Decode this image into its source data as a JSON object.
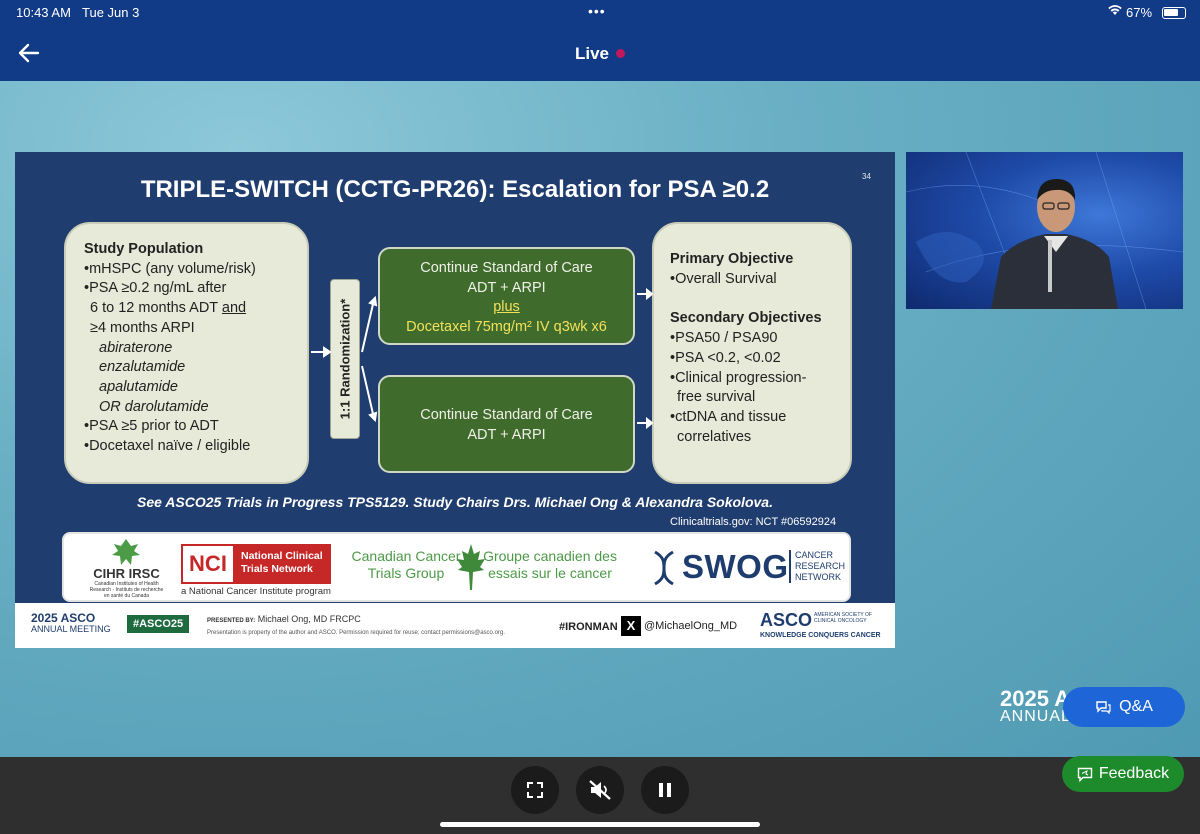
{
  "status_bar": {
    "time": "10:43 AM",
    "date": "Tue Jun 3",
    "dots": "•••",
    "battery": "67%"
  },
  "header": {
    "title": "Live"
  },
  "slide": {
    "number": "34",
    "title": "TRIPLE-SWITCH (CCTG-PR26):  Escalation for PSA ≥0.2",
    "study_population": {
      "heading": "Study Population",
      "b1": "•mHSPC (any volume/risk)",
      "b2": "•PSA ≥0.2 ng/mL after",
      "b2_l2": "6 to 12 months ADT ",
      "b2_and": "and",
      "b2_l3": "≥4 months ARPI",
      "drug1": "abiraterone",
      "drug2": "enzalutamide",
      "drug3": "apalutamide",
      "drug4": "OR darolutamide",
      "b3": "•PSA ≥5 prior to ADT",
      "b4": "•Docetaxel naïve / eligible"
    },
    "randomization": "1:1 Randomization*",
    "arm1": {
      "l1": "Continue Standard of Care",
      "l2": "ADT + ARPI",
      "plus": "plus",
      "l4": "Docetaxel 75mg/m² IV q3wk x6"
    },
    "arm2": {
      "l1": "Continue Standard of Care",
      "l2": "ADT + ARPI"
    },
    "objectives": {
      "primary_heading": "Primary Objective",
      "p1": "•Overall Survival",
      "secondary_heading": "Secondary Objectives",
      "s1": "•PSA50 / PSA90",
      "s2": "•PSA <0.2, <0.02",
      "s3": "•Clinical progression-",
      "s3b": "free survival",
      "s4": "•ctDNA and tissue",
      "s4b": "correlatives"
    },
    "caption": "See ASCO25 Trials in Progress TPS5129.   Study Chairs Drs. Michael Ong & Alexandra Sokolova.",
    "nct": "Clinicaltrials.gov:  NCT #06592924",
    "logos": {
      "cihr_left": "Canadian Institutes of Health Research",
      "cihr_right": "Instituts de recherche en santé du Canada",
      "cihr": "CIHR IRSC",
      "nci_badge": "NCI",
      "nci_name": "National Clinical Trials Network",
      "nci_sub": "a National Cancer Institute program",
      "cctg_en": "Canadian Cancer Trials Group",
      "cctg_fr": "Groupe canadien des essais sur le cancer",
      "swog": "SWOG",
      "swog_sub": "CANCER RESEARCH NETWORK"
    },
    "footer": {
      "asco_year": "2025 ASCO",
      "asco_meeting": "ANNUAL MEETING",
      "hashtag": "#ASCO25",
      "presented_by": "PRESENTED BY:",
      "presenter": "Michael Ong, MD FRCPC",
      "note": "Presentation is property of the author and ASCO. Permission required for reuse; contact permissions@asco.org.",
      "ironman": "#IRONMAN",
      "x": "X",
      "handle": "@MichaelOng_MD",
      "asco": "ASCO",
      "asco_sub": "AMERICAN SOCIETY OF CLINICAL ONCOLOGY",
      "asco_tag": "KNOWLEDGE CONQUERS CANCER"
    }
  },
  "overlay": {
    "year": "2025 A",
    "annual": "ANNUAL"
  },
  "buttons": {
    "qa": "Q&A",
    "feedback": "Feedback"
  },
  "colors": {
    "header": "#113a87",
    "slide_bg": "#1f3d6e",
    "arm_green": "#3f6b2c",
    "qa": "#1e66d8",
    "feedback": "#1d8a2b"
  }
}
